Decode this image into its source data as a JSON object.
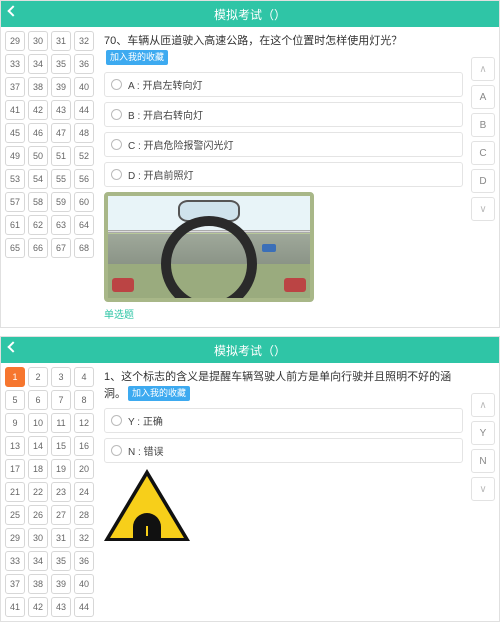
{
  "header_title": "模拟考试（）",
  "fav_tag": "加入我的收藏",
  "screens": [
    {
      "grid_start": 29,
      "grid_end": 68,
      "active": null,
      "question_no": "70、",
      "question_text": "车辆从匝道驶入高速公路，在这个位置时怎样使用灯光？",
      "options": [
        {
          "k": "A",
          "t": "开启左转向灯"
        },
        {
          "k": "B",
          "t": "开启右转向灯"
        },
        {
          "k": "C",
          "t": "开启危险报警闪光灯"
        },
        {
          "k": "D",
          "t": "开启前照灯"
        }
      ],
      "type_label": "单选题",
      "answers": [
        "A",
        "B",
        "C",
        "D"
      ],
      "image": "highway"
    },
    {
      "grid_start": 1,
      "grid_end": 44,
      "active": 1,
      "question_no": "1、",
      "question_text": "这个标志的含义是提醒车辆驾驶人前方是单向行驶并且照明不好的涵洞。",
      "options": [
        {
          "k": "Y",
          "t": "正确"
        },
        {
          "k": "N",
          "t": "错误"
        }
      ],
      "type_label": "",
      "answers": [
        "Y",
        "N"
      ],
      "image": "tunnel"
    }
  ],
  "arrow_up": "∧",
  "arrow_down": "∨"
}
